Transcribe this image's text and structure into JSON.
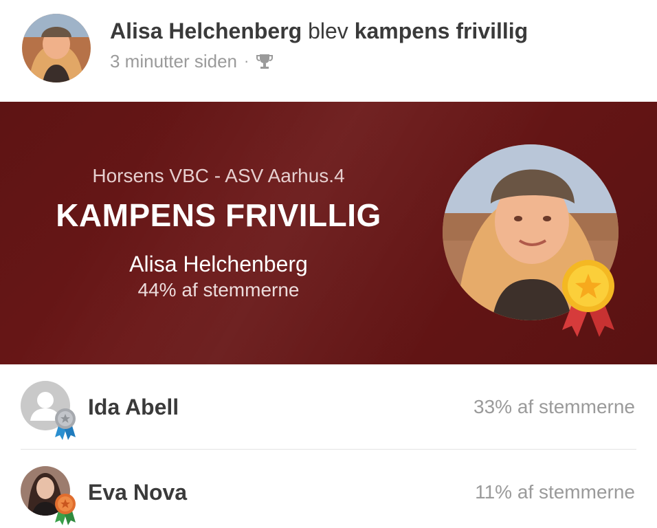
{
  "post": {
    "author_name": "Alisa Helchenberg",
    "verb": "blev",
    "award_text": "kampens frivillig",
    "time_ago": "3 minutter siden",
    "separator": "·",
    "icon": "trophy-icon"
  },
  "banner": {
    "match": "Horsens VBC - ASV Aarhus.4",
    "award_title": "KAMPENS FRIVILLIG",
    "winner_name": "Alisa Helchenberg",
    "winner_votes": "44% af stemmerne",
    "background_color": "#5e1414",
    "medal_icon": "gold-medal-icon"
  },
  "runners_up": [
    {
      "name": "Ida Abell",
      "votes": "33% af stemmerne",
      "badge": "silver-medal-icon",
      "avatar": "default-user-avatar"
    },
    {
      "name": "Eva Nova",
      "votes": "11% af stemmerne",
      "badge": "bronze-medal-icon",
      "avatar": "user-photo"
    }
  ]
}
